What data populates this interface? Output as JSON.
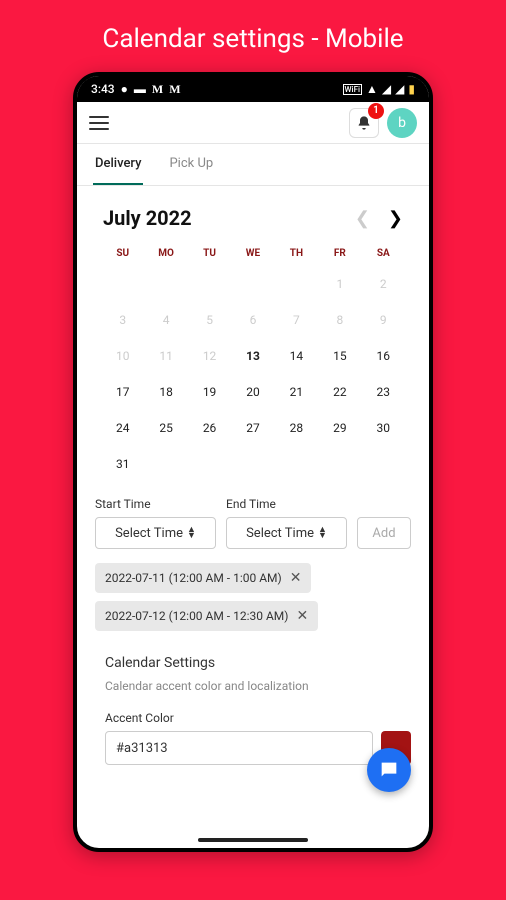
{
  "page_title": "Calendar settings - Mobile",
  "status_bar": {
    "time": "3:43"
  },
  "header": {
    "notifications_badge": "1",
    "avatar_letter": "b"
  },
  "tabs": {
    "delivery": "Delivery",
    "pickup": "Pick Up"
  },
  "calendar": {
    "title": "July 2022",
    "dow": [
      "SU",
      "MO",
      "TU",
      "WE",
      "TH",
      "FR",
      "SA"
    ],
    "days": [
      {
        "n": "",
        "dim": true
      },
      {
        "n": "",
        "dim": true
      },
      {
        "n": "",
        "dim": true
      },
      {
        "n": "",
        "dim": true
      },
      {
        "n": "",
        "dim": true
      },
      {
        "n": "1",
        "dim": true
      },
      {
        "n": "2",
        "dim": true
      },
      {
        "n": "3",
        "dim": true
      },
      {
        "n": "4",
        "dim": true
      },
      {
        "n": "5",
        "dim": true
      },
      {
        "n": "6",
        "dim": true
      },
      {
        "n": "7",
        "dim": true
      },
      {
        "n": "8",
        "dim": true
      },
      {
        "n": "9",
        "dim": true
      },
      {
        "n": "10",
        "dim": true
      },
      {
        "n": "11",
        "dim": true
      },
      {
        "n": "12",
        "dim": true
      },
      {
        "n": "13",
        "today": true
      },
      {
        "n": "14"
      },
      {
        "n": "15"
      },
      {
        "n": "16"
      },
      {
        "n": "17"
      },
      {
        "n": "18"
      },
      {
        "n": "19"
      },
      {
        "n": "20"
      },
      {
        "n": "21"
      },
      {
        "n": "22"
      },
      {
        "n": "23"
      },
      {
        "n": "24"
      },
      {
        "n": "25"
      },
      {
        "n": "26"
      },
      {
        "n": "27"
      },
      {
        "n": "28"
      },
      {
        "n": "29"
      },
      {
        "n": "30"
      },
      {
        "n": "31"
      }
    ]
  },
  "time": {
    "start_label": "Start Time",
    "end_label": "End Time",
    "select_placeholder": "Select Time",
    "add_label": "Add"
  },
  "chips": [
    "2022-07-11 (12:00 AM - 1:00 AM)",
    "2022-07-12 (12:00 AM - 12:30 AM)"
  ],
  "settings": {
    "title": "Calendar Settings",
    "desc": "Calendar accent color and localization",
    "accent_label": "Accent Color",
    "accent_value": "#a31313"
  }
}
